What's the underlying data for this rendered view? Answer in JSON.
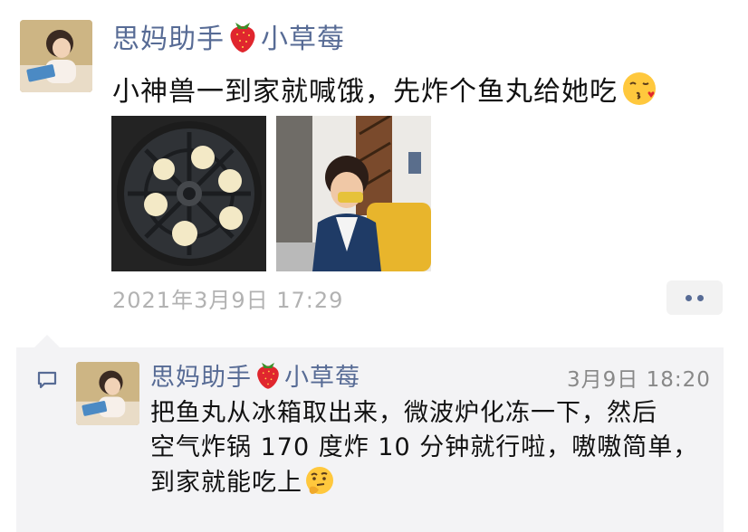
{
  "post": {
    "author": "思妈助手",
    "author_suffix": "小草莓",
    "text": "小神兽一到家就喊饿，先炸个鱼丸给她吃",
    "emoji": "kissing-face-icon",
    "timestamp": "2021年3月9日 17:29"
  },
  "comment": {
    "author": "思妈助手",
    "author_suffix": "小草莓",
    "time": "3月9日 18:20",
    "lines": [
      "把鱼丸从冰箱取出来，微波炉化冻一下，然后",
      "空气炸锅 170 度炸 10 分钟就行啦，嗷嗷简单，",
      "到家就能吃上"
    ],
    "emoji": "thinking-face-icon"
  },
  "colors": {
    "name": "#576b95",
    "timestamp": "#b2b2b2",
    "comment_bg": "#f3f3f5"
  }
}
